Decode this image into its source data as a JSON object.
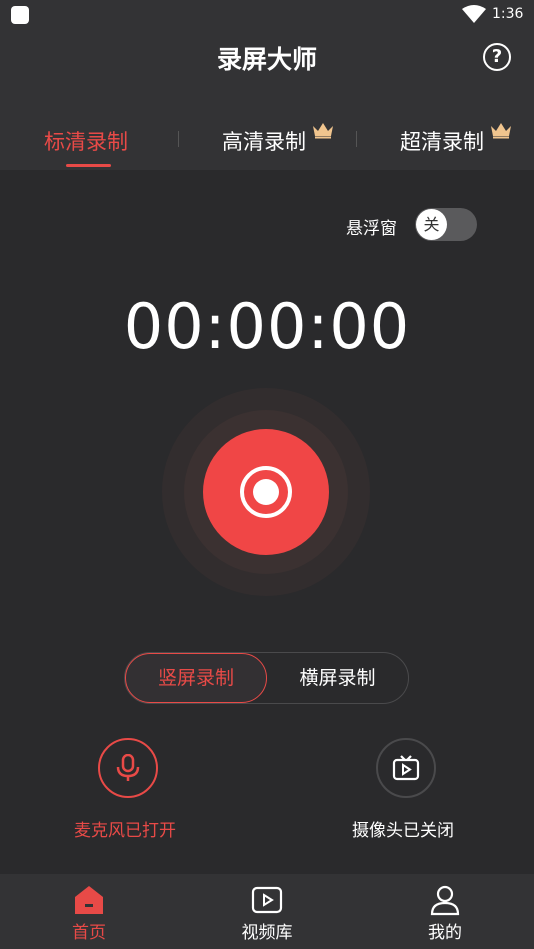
{
  "status": {
    "time": "1:36"
  },
  "header": {
    "title": "录屏大师"
  },
  "tabs": [
    {
      "label": "标清录制",
      "active": true,
      "premium": false
    },
    {
      "label": "高清录制",
      "active": false,
      "premium": true
    },
    {
      "label": "超清录制",
      "active": false,
      "premium": true
    }
  ],
  "floating_window": {
    "label": "悬浮窗",
    "toggle_text": "关",
    "on": false
  },
  "timer": "00:00:00",
  "orientation": {
    "portrait": "竖屏录制",
    "landscape": "横屏录制",
    "selected": "portrait"
  },
  "controls": {
    "mic": {
      "label": "麦克风已打开",
      "icon": "microphone-icon",
      "on": true
    },
    "camera": {
      "label": "摄像头已关闭",
      "icon": "tv-play-icon",
      "on": false
    }
  },
  "nav": [
    {
      "label": "首页",
      "icon": "home-icon",
      "active": true
    },
    {
      "label": "视频库",
      "icon": "video-library-icon",
      "active": false
    },
    {
      "label": "我的",
      "icon": "profile-icon",
      "active": false
    }
  ],
  "colors": {
    "accent": "#e84a47",
    "background": "#2a2a2c",
    "bar": "#333335",
    "record": "#f04646"
  }
}
